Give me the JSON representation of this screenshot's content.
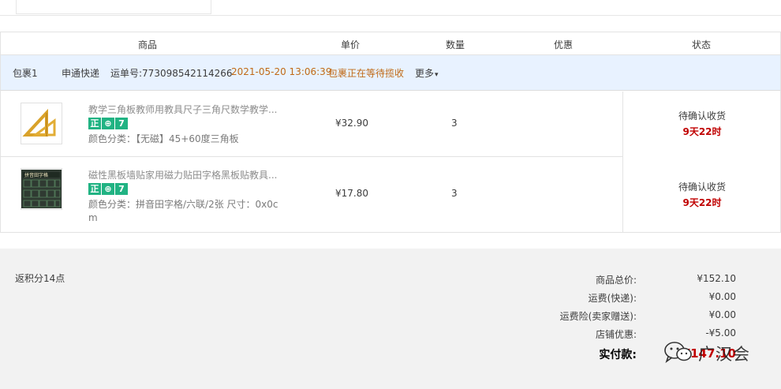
{
  "table": {
    "headers": {
      "product": "商品",
      "unit_price": "单价",
      "quantity": "数量",
      "discount": "优惠",
      "status": "状态"
    }
  },
  "package": {
    "name": "包裹1",
    "carrier": "申通快递",
    "tracking": "运单号:773098542114266",
    "time": "2021-05-20 13:06:39",
    "status": "包裹正在等待揽收",
    "more": "更多"
  },
  "items": [
    {
      "title": "教学三角板教师用教具尺子三角尺数学教学...",
      "tags": [
        "正",
        "⊕",
        "7"
      ],
      "sku_label": "颜色分类：",
      "sku_value": "【无磁】45+60度三角板",
      "price": "¥32.90",
      "qty": "3",
      "status": "待确认收货",
      "countdown": "9天22时"
    },
    {
      "title": "磁性黑板墙贴家用磁力贴田字格黑板贴教具...",
      "tags": [
        "正",
        "⊕",
        "7"
      ],
      "sku_label": "颜色分类：",
      "sku_value": "拼音田字格/六联/2张 尺寸：0x0cm",
      "price": "¥17.80",
      "qty": "3",
      "status": "待确认收货",
      "countdown": "9天22时"
    }
  ],
  "summary": {
    "points": "返积分14点",
    "rows": [
      {
        "label": "商品总价:",
        "value": "¥152.10"
      },
      {
        "label": "运费(快递):",
        "value": "¥0.00"
      },
      {
        "label": "运费险(卖家赠送):",
        "value": "¥0.00"
      },
      {
        "label": "店铺优惠:",
        "value": "-¥5.00"
      }
    ],
    "total_label": "实付款:",
    "total_value": "¥147.10"
  },
  "watermark": {
    "text": "广汉会",
    "icon": "wechat-icon"
  },
  "colors": {
    "package_bar_bg": "#e8f2ff",
    "tag_green": "#21b383",
    "countdown_red": "#c00000",
    "orange_status": "#c06a16",
    "summary_bg": "#f2f2f2"
  }
}
